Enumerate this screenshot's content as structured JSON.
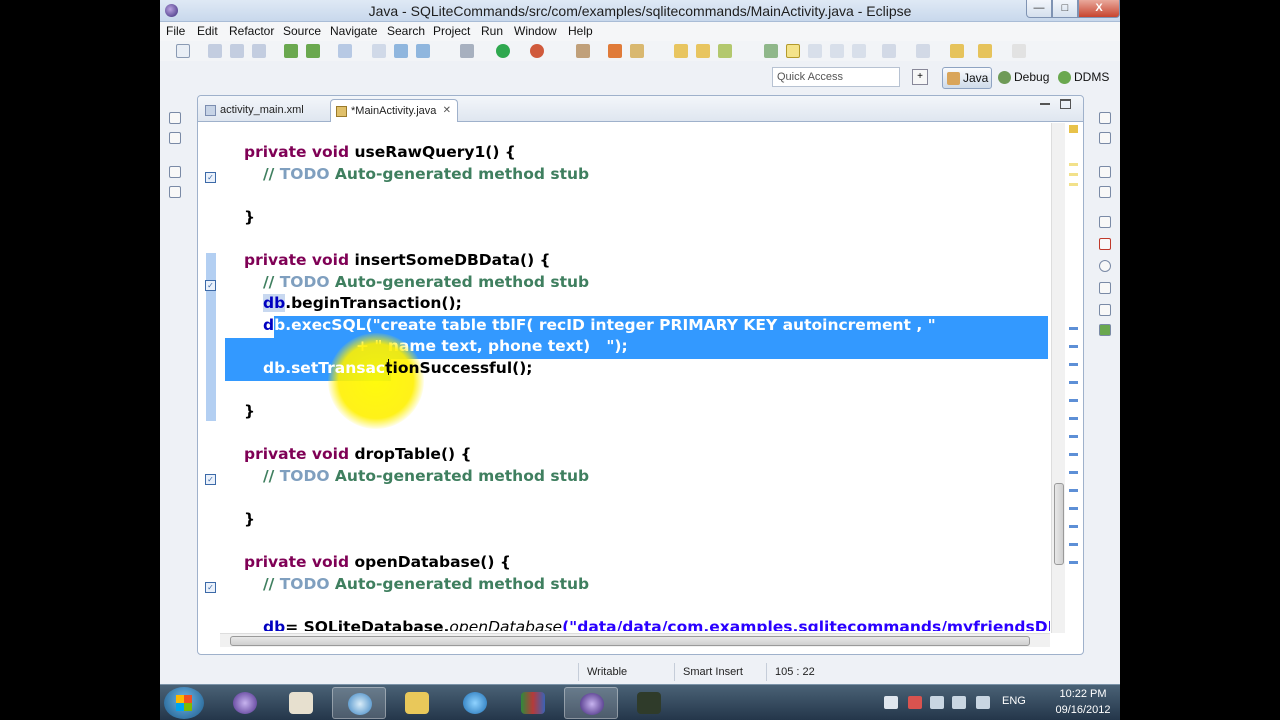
{
  "window": {
    "title": "Java - SQLiteCommands/src/com/examples/sqlitecommands/MainActivity.java - Eclipse",
    "min": "—",
    "max": "□",
    "close": "X"
  },
  "menu": [
    "File",
    "Edit",
    "Refactor",
    "Source",
    "Navigate",
    "Search",
    "Project",
    "Run",
    "Window",
    "Help"
  ],
  "quick_access": {
    "placeholder": "Quick Access"
  },
  "perspectives": {
    "java": "Java",
    "debug": "Debug",
    "ddms": "DDMS"
  },
  "tabs": [
    {
      "label": "activity_main.xml"
    },
    {
      "label": "*MainActivity.java",
      "close": "✕"
    }
  ],
  "code": {
    "lines": [
      {
        "kw": "private void ",
        "rest": "useRawQuery1() {"
      },
      {
        "cm1": "// ",
        "todo": "TODO",
        "cm2": " Auto-generated method stub"
      },
      {
        "plain": "}"
      },
      {
        "kw": "private void ",
        "rest": "insertSomeDBData() {"
      },
      {
        "cm1": "// ",
        "todo": "TODO",
        "cm2": " Auto-generated method stub"
      },
      {
        "fld": "db",
        "rest": ".beginTransaction();"
      },
      {
        "a": "d",
        "b": "b.execSQL(\"create table tblF( recID integer PRIMARY KEY autoincrement , \""
      },
      {
        "plain": "+ \" name text, phone text)   \");"
      },
      {
        "a": "db.setTransac",
        "b": "tionSuccessful();"
      },
      {
        "plain": "}"
      },
      {
        "kw": "private void ",
        "rest": "dropTable() {"
      },
      {
        "cm1": "// ",
        "todo": "TODO",
        "cm2": " Auto-generated method stub"
      },
      {
        "plain": "}"
      },
      {
        "kw": "private void ",
        "rest": "openDatabase() {"
      },
      {
        "cm1": "// ",
        "todo": "TODO",
        "cm2": " Auto-generated method stub"
      },
      {
        "fld": "db",
        "rest": "= SQLiteDatabase.",
        "it": "openDatabase",
        "str": "(\"data/data/com.examples.sqlitecommands/myfriendsDB\""
      }
    ]
  },
  "status": {
    "writable": "Writable",
    "insert": "Smart Insert",
    "position": "105 : 22"
  },
  "taskbar": {
    "lang": "ENG",
    "time": "10:22 PM",
    "date": "09/16/2012"
  }
}
